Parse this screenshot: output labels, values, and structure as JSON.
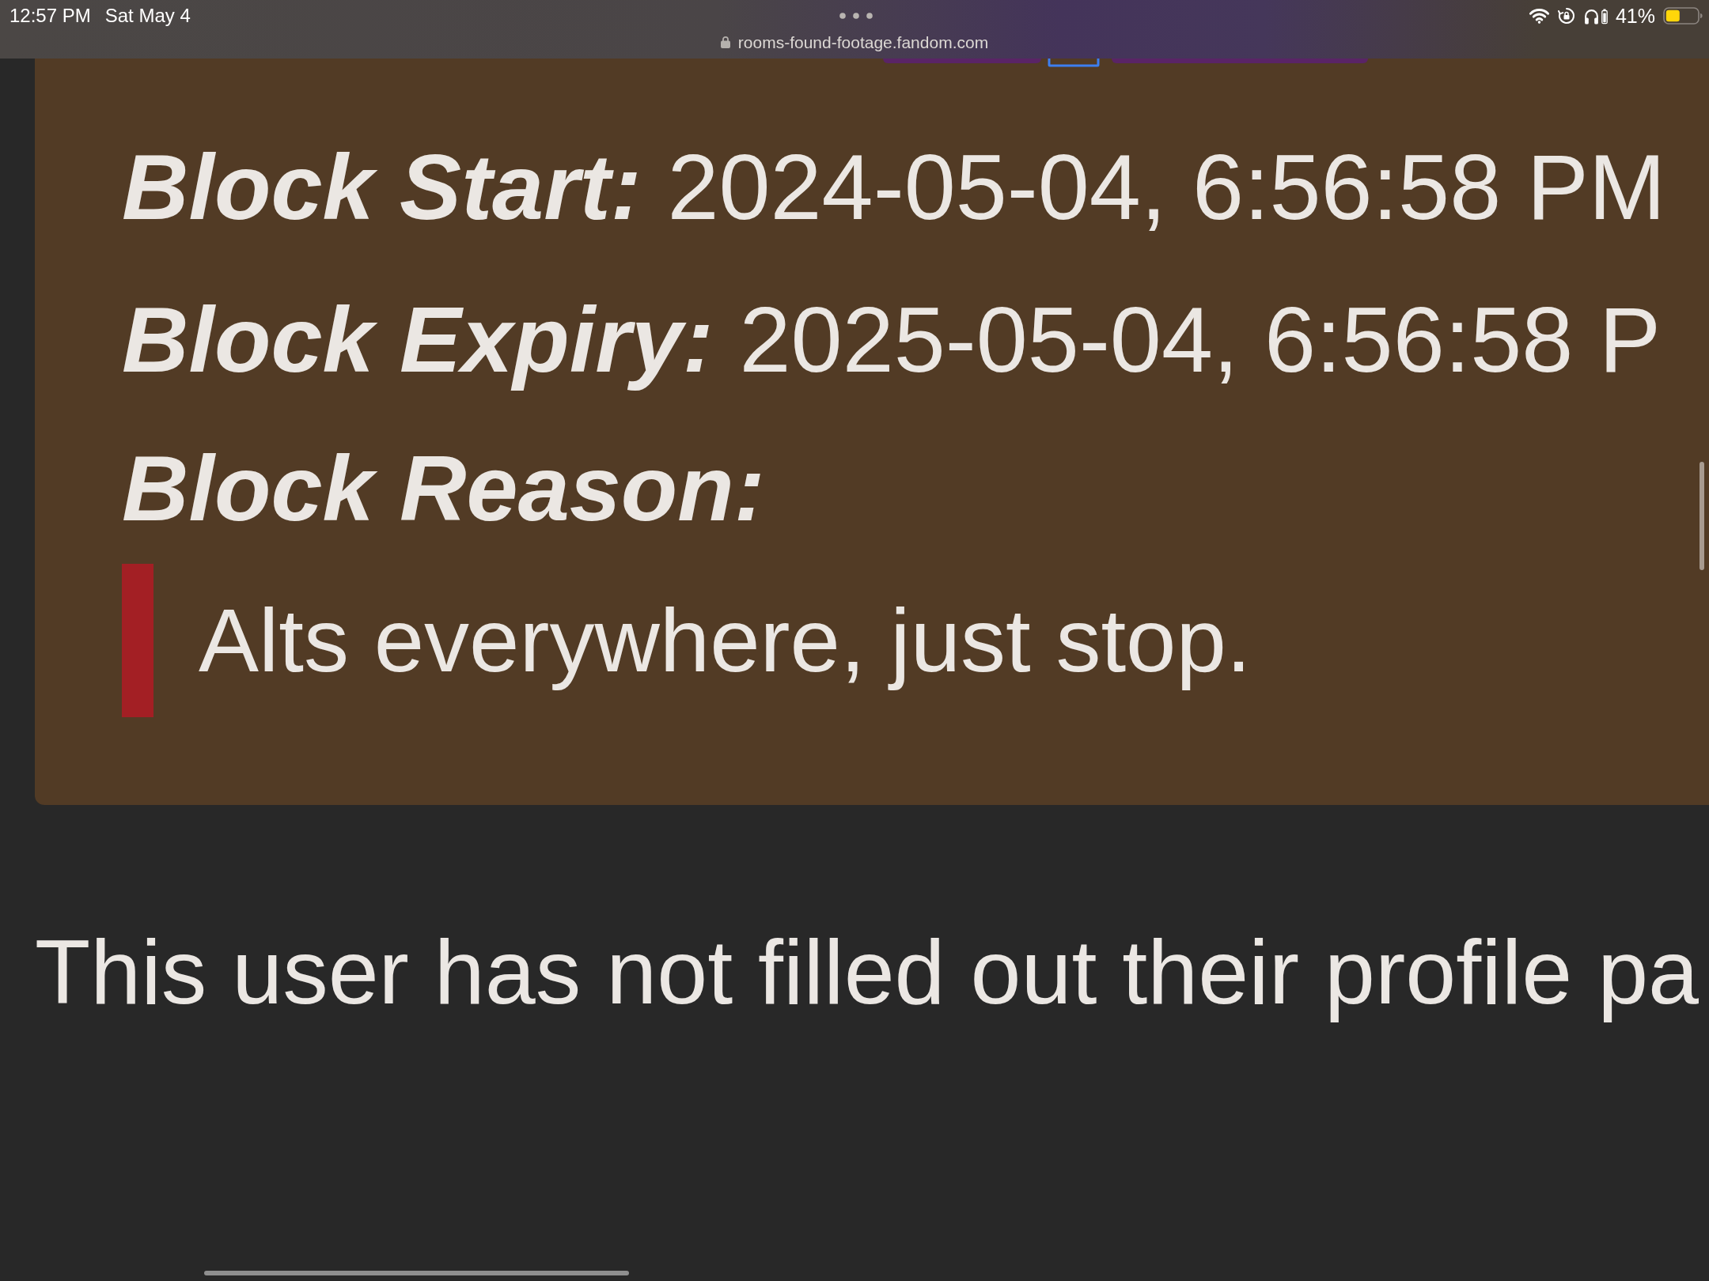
{
  "status_bar": {
    "time": "12:57 PM",
    "date": "Sat May 4",
    "battery_percent": "41%"
  },
  "address_bar": {
    "url": "rooms-found-footage.fandom.com"
  },
  "block_info": {
    "fields": [
      {
        "label": "Block Start:",
        "value": "2024-05-04, 6:56:58 PM"
      },
      {
        "label": "Block Expiry:",
        "value": "2025-05-04, 6:56:58 P"
      },
      {
        "label": "Block Reason:"
      }
    ],
    "reason_quote": "Alts everywhere, just stop."
  },
  "profile_notice": "This user has not filled out their profile pa"
}
